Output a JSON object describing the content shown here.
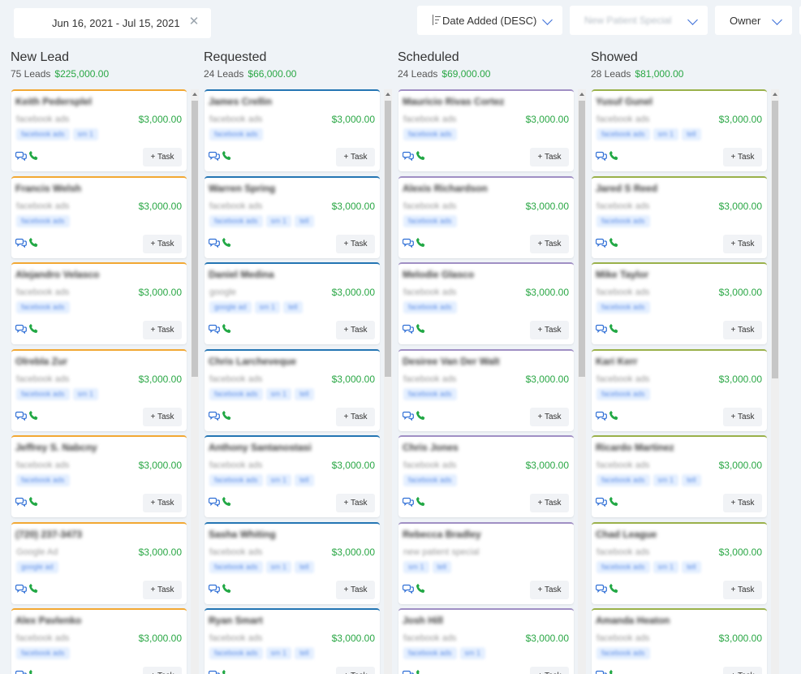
{
  "filters": {
    "date_range": "Jun 16, 2021 - Jul 15, 2021",
    "sort": "Date Added (DESC)",
    "source": "New Patient Special",
    "owner": "Owner"
  },
  "task_label": "+ Task",
  "colors": {
    "green": "#2aa745",
    "orange": "#f2a833",
    "blue": "#2475b3",
    "purple": "#a08fc4",
    "olive": "#9ab14a"
  },
  "columns": [
    {
      "title": "New Lead",
      "count": "75 Leads",
      "amount": "$225,000.00",
      "cards": [
        {
          "name": "Keith Pedersplel",
          "source": "facebook ads",
          "price": "$3,000.00",
          "tags": [
            "facebook ads",
            "sm 1"
          ]
        },
        {
          "name": "Francis Welsh",
          "source": "facebook ads",
          "price": "$3,000.00",
          "tags": [
            "facebook ads"
          ]
        },
        {
          "name": "Alejandro Velasco",
          "source": "facebook ads",
          "price": "$3,000.00",
          "tags": [
            "facebook ads"
          ]
        },
        {
          "name": "Olrebla Zur",
          "source": "facebook ads",
          "price": "$3,000.00",
          "tags": [
            "facebook ads",
            "sm 1"
          ]
        },
        {
          "name": "Jeffrey S. Nabcny",
          "source": "facebook ads",
          "price": "$3,000.00",
          "tags": [
            "facebook ads"
          ]
        },
        {
          "name": "(720) 237-3473",
          "source": "Google Ad",
          "price": "$3,000.00",
          "tags": [
            "google ad"
          ]
        },
        {
          "name": "Alex Pavlenko",
          "source": "facebook ads",
          "price": "$3,000.00",
          "tags": [
            "facebook ads"
          ]
        }
      ]
    },
    {
      "title": "Requested",
      "count": "24 Leads",
      "amount": "$66,000.00",
      "cards": [
        {
          "name": "James Crellin",
          "source": "facebook ads",
          "price": "$3,000.00",
          "tags": [
            "facebook ads"
          ]
        },
        {
          "name": "Warren Spring",
          "source": "facebook ads",
          "price": "$3,000.00",
          "tags": [
            "facebook ads",
            "sm 1",
            "tell"
          ]
        },
        {
          "name": "Daniel Medina",
          "source": "google",
          "price": "$3,000.00",
          "tags": [
            "google ad",
            "sm 1",
            "tell"
          ]
        },
        {
          "name": "Chris Larcheveque",
          "source": "facebook ads",
          "price": "$3,000.00",
          "tags": [
            "facebook ads",
            "sm 1",
            "tell"
          ]
        },
        {
          "name": "Anthony Santanostasi",
          "source": "facebook ads",
          "price": "$3,000.00",
          "tags": [
            "facebook ads",
            "sm 1",
            "tell"
          ]
        },
        {
          "name": "Sasha Whiting",
          "source": "facebook ads",
          "price": "$3,000.00",
          "tags": [
            "facebook ads",
            "sm 1",
            "tell"
          ]
        },
        {
          "name": "Ryan Smart",
          "source": "facebook ads",
          "price": "$3,000.00",
          "tags": [
            "facebook ads",
            "sm 1",
            "tell"
          ]
        }
      ]
    },
    {
      "title": "Scheduled",
      "count": "24 Leads",
      "amount": "$69,000.00",
      "cards": [
        {
          "name": "Mauricio Rivas Cortez",
          "source": "facebook ads",
          "price": "$3,000.00",
          "tags": [
            "facebook ads"
          ]
        },
        {
          "name": "Alexis Richardson",
          "source": "facebook ads",
          "price": "$3,000.00",
          "tags": [
            "facebook ads"
          ]
        },
        {
          "name": "Melodie Glasco",
          "source": "facebook ads",
          "price": "$3,000.00",
          "tags": [
            "facebook ads"
          ]
        },
        {
          "name": "Desiree Van Der Walt",
          "source": "facebook ads",
          "price": "$3,000.00",
          "tags": [
            "facebook ads"
          ]
        },
        {
          "name": "Chris Jones",
          "source": "facebook ads",
          "price": "$3,000.00",
          "tags": [
            "facebook ads"
          ]
        },
        {
          "name": "Rebecca Bradley",
          "source": "new patient special",
          "price": "",
          "tags": [
            "sm 1",
            "tell"
          ]
        },
        {
          "name": "Josh Hill",
          "source": "facebook ads",
          "price": "$3,000.00",
          "tags": [
            "facebook ads",
            "sm 1"
          ]
        }
      ]
    },
    {
      "title": "Showed",
      "count": "28 Leads",
      "amount": "$81,000.00",
      "cards": [
        {
          "name": "Yusuf Gunel",
          "source": "facebook ads",
          "price": "$3,000.00",
          "tags": [
            "facebook ads",
            "sm 1",
            "tell"
          ]
        },
        {
          "name": "Jared S Reed",
          "source": "facebook ads",
          "price": "$3,000.00",
          "tags": [
            "facebook ads"
          ]
        },
        {
          "name": "Mike Taylor",
          "source": "facebook ads",
          "price": "$3,000.00",
          "tags": [
            "facebook ads"
          ]
        },
        {
          "name": "Kari Kerr",
          "source": "facebook ads",
          "price": "$3,000.00",
          "tags": [
            "facebook ads"
          ]
        },
        {
          "name": "Ricardo Martinez",
          "source": "facebook ads",
          "price": "$3,000.00",
          "tags": [
            "facebook ads",
            "sm 1",
            "tell"
          ]
        },
        {
          "name": "Chad League",
          "source": "facebook ads",
          "price": "$3,000.00",
          "tags": [
            "facebook ads",
            "sm 1",
            "tell"
          ]
        },
        {
          "name": "Amanda Heaton",
          "source": "facebook ads",
          "price": "$3,000.00",
          "tags": [
            "facebook ads"
          ]
        }
      ]
    }
  ]
}
